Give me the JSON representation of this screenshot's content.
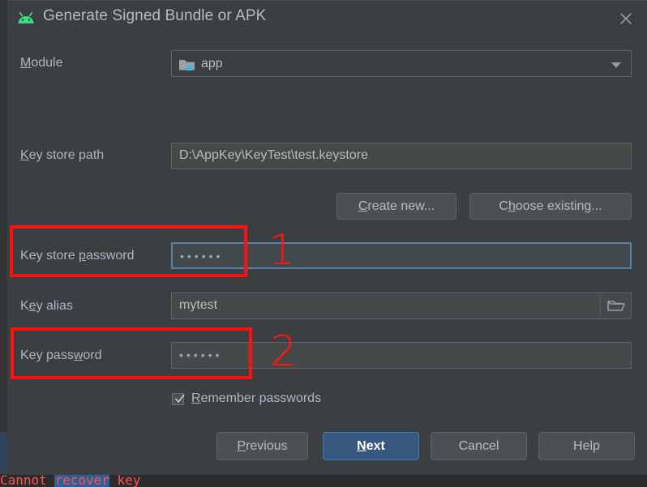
{
  "window": {
    "title": "Generate Signed Bundle or APK",
    "app_icon": "android-robot-icon",
    "close_icon": "close-icon"
  },
  "form": {
    "module": {
      "label": "Module",
      "label_mnemonic": "M",
      "value": "app",
      "icon": "module-folder-icon",
      "dropdown_icon": "chevron-down-icon"
    },
    "key_store_path": {
      "label_pre": "K",
      "label_mnemonic": "e",
      "label_post": "y store path",
      "label": "Key store path",
      "value": "D:\\AppKey\\KeyTest\\test.keystore"
    },
    "create_new": {
      "label_pre": "",
      "mnemonic": "C",
      "label_post": "reate new...",
      "label": "Create new..."
    },
    "choose_existing": {
      "label_pre": "C",
      "mnemonic": "h",
      "label_post": "oose existing...",
      "label": "Choose existing..."
    },
    "key_store_password": {
      "label_pre": "Key store ",
      "mnemonic": "p",
      "label_post": "assword",
      "label": "Key store password",
      "value": "••••••",
      "focused": true
    },
    "key_alias": {
      "label_pre": "K",
      "mnemonic": "e",
      "label_post": "y alias",
      "label": "Key alias",
      "value": "mytest",
      "browse_icon": "folder-open-icon"
    },
    "key_password": {
      "label_pre": "Key pass",
      "mnemonic": "w",
      "label_post": "ord",
      "label": "Key password",
      "value": "••••••",
      "focused": false
    },
    "remember_passwords": {
      "label_pre": "",
      "mnemonic": "R",
      "label_post": "emember passwords",
      "label": "Remember passwords",
      "checked": true
    }
  },
  "buttons": {
    "previous": {
      "label_pre": "",
      "mnemonic": "P",
      "label_post": "revious",
      "label": "Previous"
    },
    "next": {
      "label_pre": "",
      "mnemonic": "N",
      "label_post": "ext",
      "label": "Next",
      "default": true
    },
    "cancel": {
      "label": "Cancel"
    },
    "help": {
      "label": "Help"
    }
  },
  "background_editor": {
    "text_part1": "Cannot ",
    "text_selected": "recover",
    "text_part2": " key"
  },
  "annotations": {
    "box1_number": "1",
    "box2_number": "2",
    "color": "#ff0f0f"
  }
}
